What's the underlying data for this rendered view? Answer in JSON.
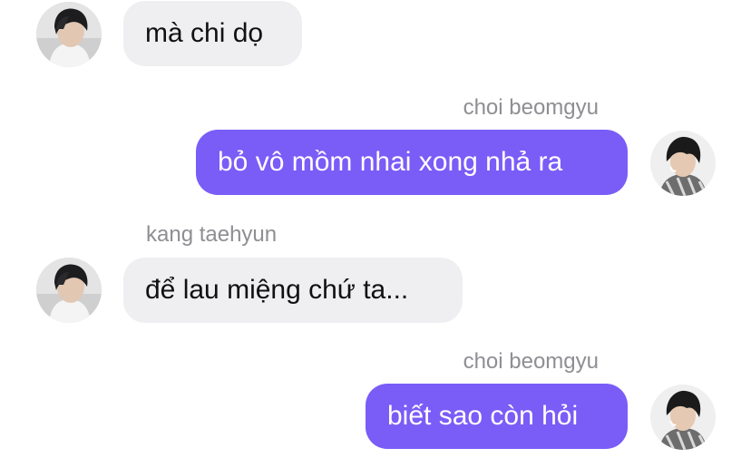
{
  "colors": {
    "outgoing_bubble": "#7a5cf7",
    "incoming_bubble": "#efeff1",
    "sender_name": "#8e8e93"
  },
  "messages": [
    {
      "direction": "incoming",
      "sender": "",
      "text": "mà chi dọ",
      "avatar": "taehyun-avatar"
    },
    {
      "direction": "outgoing",
      "sender": "choi beomgyu",
      "text": "bỏ vô mồm nhai xong nhả ra",
      "avatar": "beomgyu-avatar"
    },
    {
      "direction": "incoming",
      "sender": "kang taehyun",
      "text": "để lau miệng chứ ta...",
      "avatar": "taehyun-avatar"
    },
    {
      "direction": "outgoing",
      "sender": "choi beomgyu",
      "text": "biết sao còn hỏi",
      "avatar": "beomgyu-avatar"
    }
  ]
}
